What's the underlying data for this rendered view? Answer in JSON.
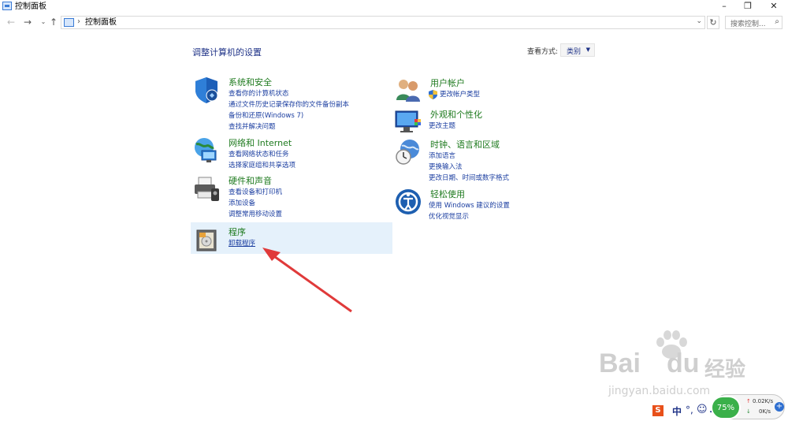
{
  "window": {
    "title": "控制面板"
  },
  "controls": {
    "minimize": "–",
    "restore": "❐",
    "close": "✕"
  },
  "nav": {
    "back": "←",
    "forward": "→",
    "history": "⌄",
    "up": "↑",
    "separator": "›",
    "dropdown": "⌄",
    "refresh": "↻"
  },
  "address": {
    "crumb": "控制面板"
  },
  "search": {
    "placeholder": "搜索控制...",
    "icon": "⌕"
  },
  "main": {
    "title": "调整计算机的设置",
    "view_by_label": "查看方式:",
    "view_by_value": "类别",
    "view_by_arrow": "▼"
  },
  "categories": {
    "system": {
      "title": "系统和安全",
      "links": [
        "查看你的计算机状态",
        "通过文件历史记录保存你的文件备份副本",
        "备份和还原(Windows 7)",
        "查找并解决问题"
      ]
    },
    "network": {
      "title": "网络和 Internet",
      "links": [
        "查看网络状态和任务",
        "选择家庭组和共享选项"
      ]
    },
    "hardware": {
      "title": "硬件和声音",
      "links": [
        "查看设备和打印机",
        "添加设备",
        "调整常用移动设置"
      ]
    },
    "programs": {
      "title": "程序",
      "links": [
        "卸载程序"
      ]
    },
    "users": {
      "title": "用户帐户",
      "links": [
        "更改帐户类型"
      ]
    },
    "appearance": {
      "title": "外观和个性化",
      "links": [
        "更改主题"
      ]
    },
    "clock": {
      "title": "时钟、语言和区域",
      "links": [
        "添加语言",
        "更换输入法",
        "更改日期、时间或数字格式"
      ]
    },
    "ease": {
      "title": "轻松使用",
      "links": [
        "使用 Windows 建议的设置",
        "优化视觉显示"
      ]
    }
  },
  "watermark": {
    "brand": "Bai",
    "brand2": "du",
    "cn": "经验",
    "url": "jingyan.baidu.com"
  },
  "tray": {
    "ime": "中",
    "cpu": "75%",
    "up_speed": "0.02K/s",
    "down_speed": "0K/s"
  },
  "colors": {
    "link": "#1b3ea0",
    "heading": "#1e7a1e",
    "highlight": "#e5f1fb",
    "arrow": "#e03a3a"
  }
}
